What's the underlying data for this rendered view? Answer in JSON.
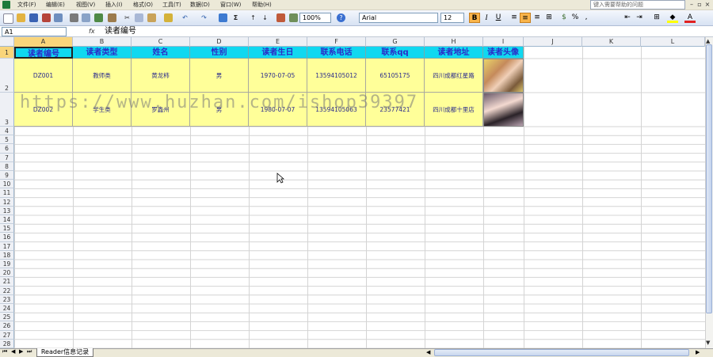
{
  "menu": {
    "items": [
      "文件(F)",
      "编辑(E)",
      "视图(V)",
      "插入(I)",
      "格式(O)",
      "工具(T)",
      "数据(D)",
      "窗口(W)",
      "帮助(H)"
    ],
    "help_placeholder": "键入需要帮助的问题"
  },
  "toolbar": {
    "zoom": "100%",
    "font_name": "Arial",
    "font_size": "12",
    "bold": "B",
    "italic": "I",
    "underline": "U"
  },
  "formula_bar": {
    "name_box": "A1",
    "fx": "fx",
    "content": "读者编号"
  },
  "columns": [
    "A",
    "B",
    "C",
    "D",
    "E",
    "F",
    "G",
    "H",
    "I",
    "J",
    "K",
    "L"
  ],
  "rows": [
    "1",
    "2",
    "3",
    "4",
    "5",
    "6",
    "7",
    "8",
    "9",
    "10",
    "11",
    "12",
    "13",
    "14",
    "15",
    "16",
    "17",
    "18",
    "19",
    "20",
    "21",
    "22",
    "23",
    "24",
    "25",
    "26",
    "27",
    "28"
  ],
  "table": {
    "headers": [
      "读者编号",
      "读者类型",
      "姓名",
      "性别",
      "读者生日",
      "联系电话",
      "联系qq",
      "读者地址",
      "读者头像"
    ],
    "rows": [
      [
        "DZ001",
        "教师类",
        "黄龙柿",
        "男",
        "1970-07-05",
        "13594105012",
        "65105175",
        "四川成都红星路"
      ],
      [
        "DZ002",
        "学生类",
        "罗鑫州",
        "男",
        "1980-07-07",
        "13594105063",
        "23577421",
        "四川成都十里店"
      ]
    ]
  },
  "sheet_tab": "Reader信息记录",
  "watermark": "https://www.huzhan.com/ishop39397",
  "colors": {
    "header_fill": "#10d8f0",
    "header_text": "#2b2bc8",
    "data_fill": "#ffff99",
    "selection": "#f9d57b"
  }
}
